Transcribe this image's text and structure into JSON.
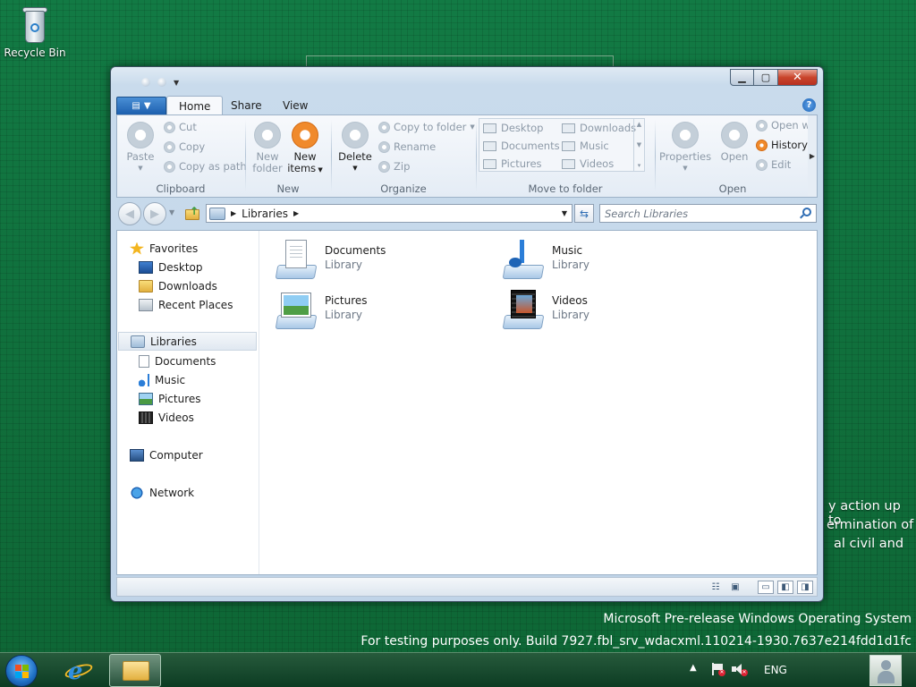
{
  "desktop": {
    "recycle_bin": "Recycle Bin",
    "eula_lines": [
      "y action up to",
      "ermination of",
      "al civil and"
    ],
    "watermark_line1": "Microsoft Pre-release Windows Operating System",
    "watermark_line2": "For testing purposes only. Build 7927.fbl_srv_wdacxml.110214-1930.7637e214fdd1d1fc"
  },
  "ribbon": {
    "file_menu_icon": "file-menu-icon",
    "tabs": [
      "Home",
      "Share",
      "View"
    ],
    "active_tab": "Home",
    "clipboard": {
      "label": "Clipboard",
      "paste": "Paste",
      "cut": "Cut",
      "copy": "Copy",
      "copy_as_path": "Copy as path"
    },
    "new": {
      "label": "New",
      "new_folder_l1": "New",
      "new_folder_l2": "folder",
      "new_items_l1": "New",
      "new_items_l2": "items"
    },
    "organize": {
      "label": "Organize",
      "delete": "Delete",
      "copy_to_folder": "Copy to folder",
      "rename": "Rename",
      "zip": "Zip"
    },
    "move_to_folder": {
      "label": "Move to folder",
      "items": [
        "Desktop",
        "Downloads",
        "Documents",
        "Music",
        "Pictures",
        "Videos"
      ]
    },
    "open": {
      "label": "Open",
      "properties": "Properties",
      "open": "Open",
      "open_with": "Open w",
      "history": "History",
      "edit": "Edit"
    }
  },
  "addressbar": {
    "path": "Libraries",
    "search_placeholder": "Search Libraries"
  },
  "navpane": {
    "favorites": "Favorites",
    "favorite_items": [
      "Desktop",
      "Downloads",
      "Recent Places"
    ],
    "libraries": "Libraries",
    "library_items": [
      "Documents",
      "Music",
      "Pictures",
      "Videos"
    ],
    "computer": "Computer",
    "network": "Network"
  },
  "libraries": [
    {
      "name": "Documents",
      "type": "Library",
      "icon": "documents-library-icon"
    },
    {
      "name": "Music",
      "type": "Library",
      "icon": "music-library-icon"
    },
    {
      "name": "Pictures",
      "type": "Library",
      "icon": "pictures-library-icon"
    },
    {
      "name": "Videos",
      "type": "Library",
      "icon": "videos-library-icon"
    }
  ],
  "taskbar": {
    "language": "ENG"
  },
  "colors": {
    "accent_orange": "#f08a2c",
    "desktop_green": "#0f6a3a",
    "close_red": "#c9452c"
  }
}
